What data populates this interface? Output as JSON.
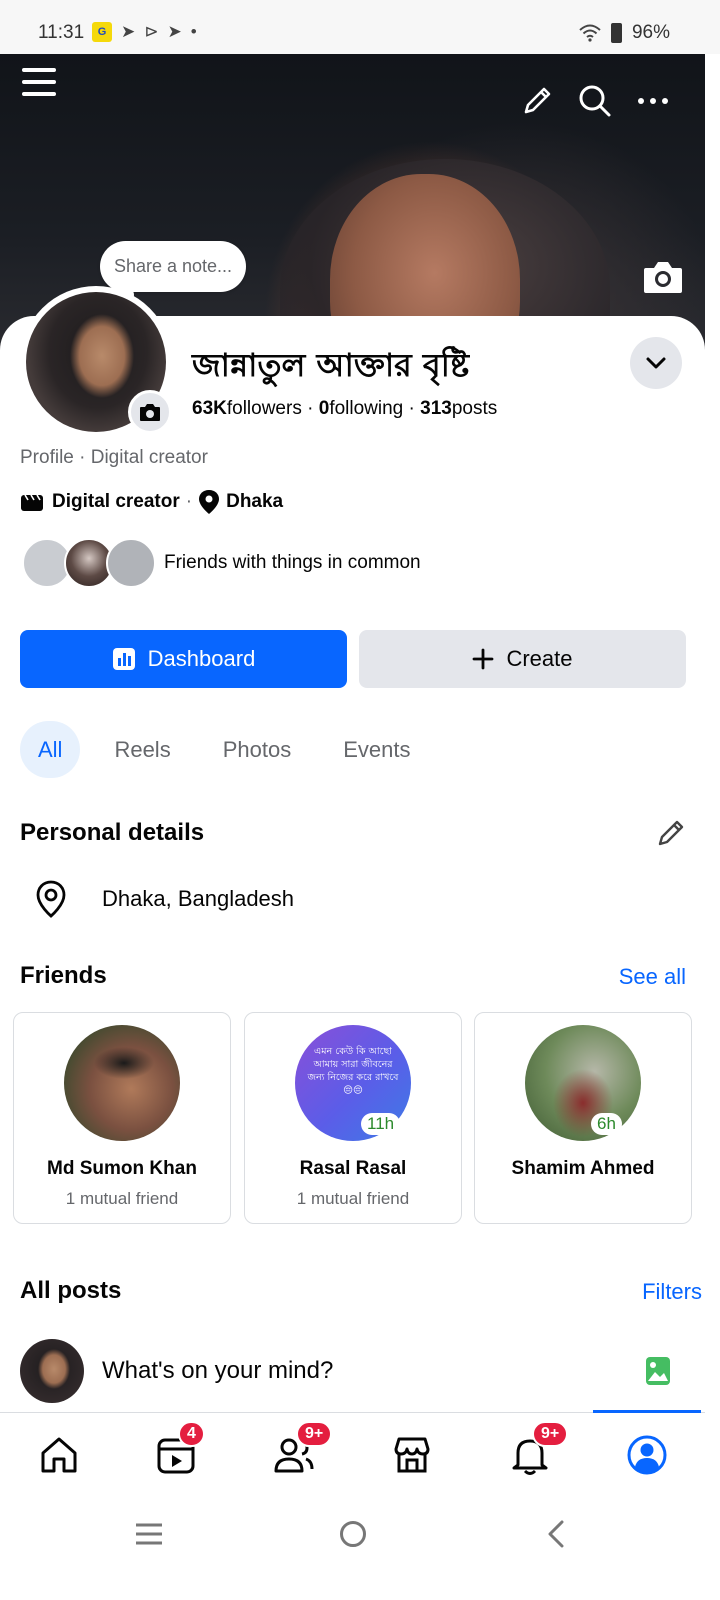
{
  "status_bar": {
    "time": "11:31",
    "battery": "96%"
  },
  "cover": {
    "note_placeholder": "Share a note..."
  },
  "profile": {
    "name": "জান্নাতুল আক্তার বৃষ্টি",
    "followers_count": "63K",
    "followers_label": "followers",
    "following_count": "0",
    "following_label": "following",
    "posts_count": "313",
    "posts_label": "posts",
    "type": "Profile · Digital creator",
    "category": "Digital creator",
    "location": "Dhaka",
    "friends_common": "Friends with things in common"
  },
  "actions": {
    "dashboard": "Dashboard",
    "create": "Create"
  },
  "tabs": [
    "All",
    "Reels",
    "Photos",
    "Events"
  ],
  "personal_details": {
    "title": "Personal details",
    "location": "Dhaka, Bangladesh"
  },
  "friends": {
    "title": "Friends",
    "see_all": "See all",
    "cards": [
      {
        "name": "Md Sumon Khan",
        "mutual": "1 mutual friend",
        "badge": ""
      },
      {
        "name": "Rasal Rasal",
        "mutual": "1 mutual friend",
        "badge": "11h",
        "story_text": "এমন কেউ কি আছো আমায় সারা জীবনের জন্য নিজের করে রাখবে 😔😔"
      },
      {
        "name": "Shamim Ahmed",
        "mutual": "",
        "badge": "6h"
      }
    ]
  },
  "posts": {
    "title": "All posts",
    "filters": "Filters",
    "composer_placeholder": "What's on your mind?"
  },
  "bottom_nav": {
    "video_badge": "4",
    "friends_badge": "9+",
    "notifications_badge": "9+"
  },
  "colors": {
    "accent": "#0866ff",
    "badge": "#e41e3f"
  }
}
